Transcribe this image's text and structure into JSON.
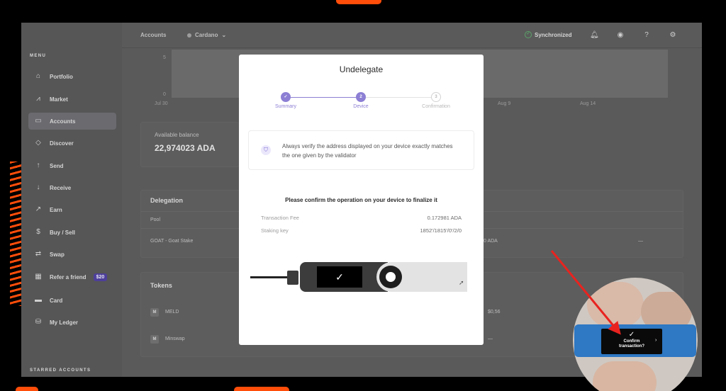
{
  "sidebar": {
    "menu_title": "MENU",
    "items": [
      {
        "label": "Portfolio",
        "icon": "home-icon"
      },
      {
        "label": "Market",
        "icon": "chart-icon"
      },
      {
        "label": "Accounts",
        "icon": "wallet-icon"
      },
      {
        "label": "Discover",
        "icon": "compass-icon"
      },
      {
        "label": "Send",
        "icon": "send-icon"
      },
      {
        "label": "Receive",
        "icon": "receive-icon"
      },
      {
        "label": "Earn",
        "icon": "earn-icon"
      },
      {
        "label": "Buy / Sell",
        "icon": "exchange-icon"
      },
      {
        "label": "Swap",
        "icon": "swap-icon"
      },
      {
        "label": "Refer a friend",
        "icon": "gift-icon",
        "badge": "$20"
      },
      {
        "label": "Card",
        "icon": "card-icon"
      },
      {
        "label": "My Ledger",
        "icon": "ledger-icon"
      }
    ],
    "active_item": "Accounts",
    "starred_title": "STARRED ACCOUNTS"
  },
  "topbar": {
    "breadcrumb_accounts": "Accounts",
    "breadcrumb_coin": "Cardano",
    "sync_status": "Synchronized"
  },
  "account": {
    "chart_axis": {
      "y_top": "5",
      "y_bottom": "0",
      "x_labels": [
        "Jul 30",
        "Aug 9",
        "Aug 14"
      ]
    },
    "available_balance_label": "Available balance",
    "available_balance_value": "22,974023 ADA"
  },
  "delegation": {
    "title": "Delegation",
    "header_pool": "Pool",
    "pool_name": "GOAT - Goat Stake",
    "rewards_partial": "0 ADA",
    "more": "—"
  },
  "tokens": {
    "title": "Tokens",
    "items": [
      {
        "initial": "M",
        "name": "MELD",
        "value": "$0,56"
      },
      {
        "initial": "M",
        "name": "Minswap",
        "value": "—"
      }
    ]
  },
  "modal": {
    "title": "Undelegate",
    "steps": [
      {
        "number": "1",
        "label": "Summary",
        "state": "done"
      },
      {
        "number": "2",
        "label": "Device",
        "state": "current"
      },
      {
        "number": "3",
        "label": "Confirmation",
        "state": "todo"
      }
    ],
    "notice": "Always verify the address displayed on your device exactly matches the one given by the validator",
    "confirm_message": "Please confirm the operation on your device to finalize it",
    "fields": [
      {
        "label": "Transaction Fee",
        "value": "0.172981 ADA"
      },
      {
        "label": "Staking key",
        "value": "1852'/1815'/0'/2/0"
      }
    ]
  },
  "inset": {
    "device_text_line1": "Confirm",
    "device_text_line2": "transaction?"
  },
  "colors": {
    "accent": "#8c7fd4",
    "sync_green": "#5aa36a",
    "highlight_orange": "#ff4d0a",
    "arrow_red": "#e8231f"
  }
}
